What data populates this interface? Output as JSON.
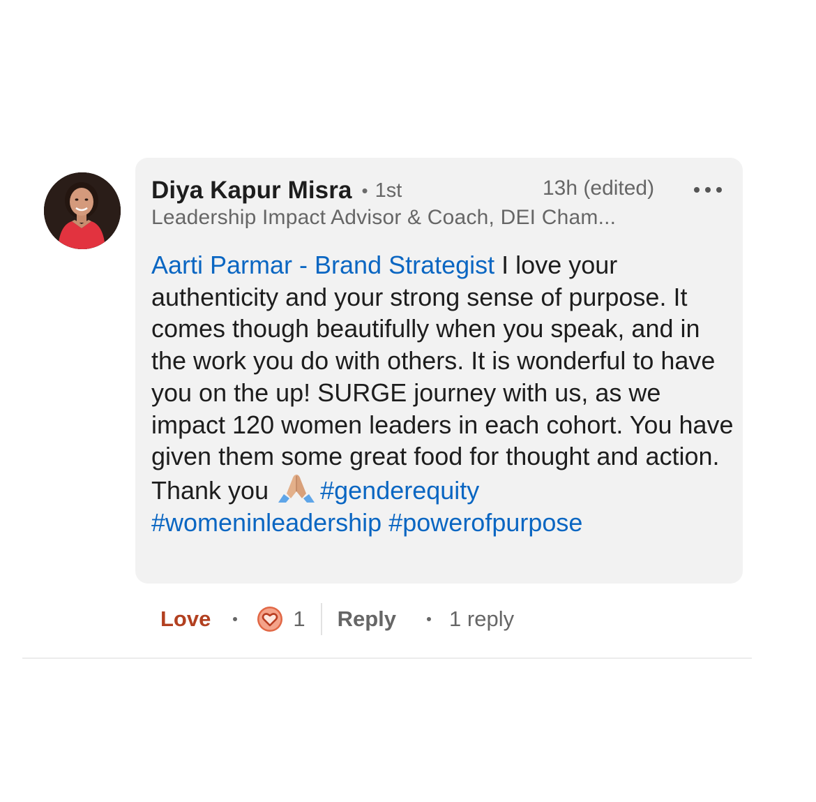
{
  "comment": {
    "author": {
      "name": "Diya Kapur Misra",
      "degree": "1st",
      "headline": "Leadership Impact Advisor & Coach, DEI Cham..."
    },
    "timestamp": "13h (edited)",
    "body": {
      "mention": "Aarti Parmar - Brand Strategist",
      "text": " I love your authenticity and your strong sense of purpose. It comes though beautifully when you speak, and in the work you do with others. It is wonderful to have you on the up! SURGE journey with us, as we impact 120 women leaders in each cohort. You have given them some great food for thought and action. Thank you ",
      "emoji": "folded-hands-emoji",
      "hashtags": [
        "#genderequity",
        "#womeninleadership",
        "#powerofpurpose"
      ]
    },
    "actions": {
      "reaction_label": "Love",
      "reaction_icon": "heart-icon",
      "reaction_count": "1",
      "reply_label": "Reply",
      "replies_text": "1 reply"
    }
  },
  "colors": {
    "link": "#0a66c2",
    "love": "#b24020",
    "bubble": "#f2f2f2",
    "heart_badge": "#e16745"
  }
}
